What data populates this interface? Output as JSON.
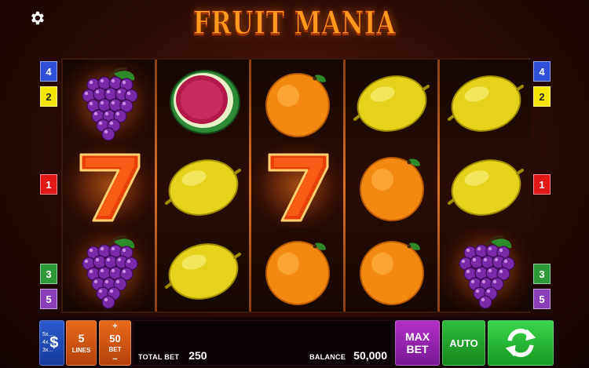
{
  "game": {
    "title": "FRUIT MANIA"
  },
  "settings": {
    "icon": "gear-icon"
  },
  "paylines": {
    "left": [
      {
        "label": "4",
        "color": "#2f4fd8",
        "text": "#fff"
      },
      {
        "label": "2",
        "color": "#f2e600",
        "text": "#222"
      },
      {
        "label": "1",
        "color": "#e01818",
        "text": "#fff"
      },
      {
        "label": "3",
        "color": "#2d9a38",
        "text": "#fff"
      },
      {
        "label": "5",
        "color": "#8a3fb8",
        "text": "#fff"
      }
    ],
    "right": [
      {
        "label": "4",
        "color": "#2f4fd8",
        "text": "#fff"
      },
      {
        "label": "2",
        "color": "#f2e600",
        "text": "#222"
      },
      {
        "label": "1",
        "color": "#e01818",
        "text": "#fff"
      },
      {
        "label": "3",
        "color": "#2d9a38",
        "text": "#fff"
      },
      {
        "label": "5",
        "color": "#8a3fb8",
        "text": "#fff"
      }
    ]
  },
  "reels": [
    [
      "grapes",
      "seven",
      "grapes"
    ],
    [
      "watermelon",
      "lemon",
      "lemon"
    ],
    [
      "orange",
      "seven",
      "orange"
    ],
    [
      "lemon",
      "orange",
      "orange"
    ],
    [
      "lemon",
      "lemon",
      "grapes"
    ]
  ],
  "controls": {
    "currency": {
      "lines": [
        "5x...",
        "4x...",
        "3x..."
      ],
      "symbol": "$"
    },
    "lines": {
      "value": "5",
      "label": "LINES"
    },
    "bet": {
      "plus": "+",
      "value": "50",
      "label": "BET",
      "minus": "−"
    },
    "total_bet": {
      "label": "TOTAL BET",
      "value": "250"
    },
    "balance": {
      "label": "BALANCE",
      "value": "50,000"
    },
    "max_bet": {
      "line1": "MAX",
      "line2": "BET"
    },
    "auto": {
      "label": "AUTO"
    },
    "spin": {
      "icon": "spin-arrows-icon"
    }
  }
}
